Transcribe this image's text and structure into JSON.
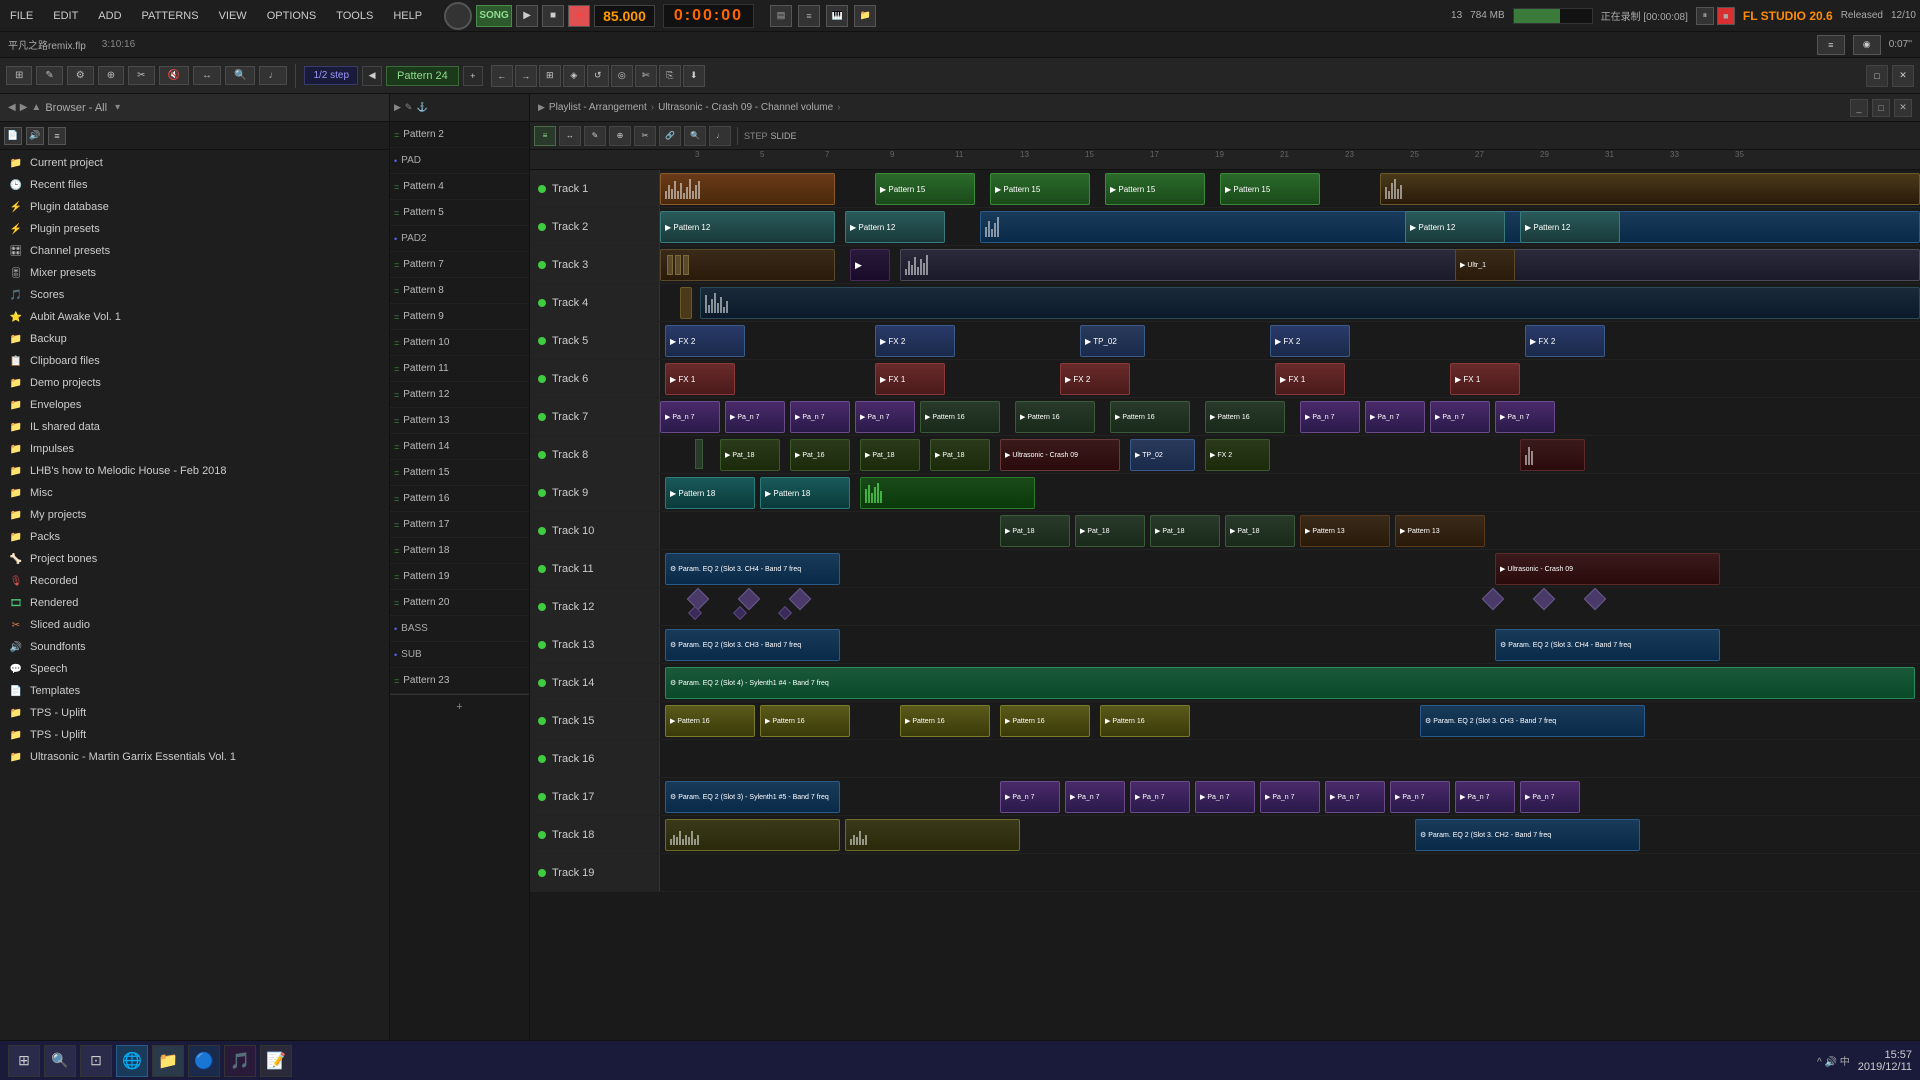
{
  "window": {
    "title": "平凡之路remix.flp",
    "time_code": "3:10:16",
    "record_time": "0:07''",
    "fl_version": "FL STUDIO 20.6",
    "release": "Released",
    "date_time": "12/10",
    "recording_time": "[00:00:08]"
  },
  "menu": {
    "items": [
      "FILE",
      "EDIT",
      "ADD",
      "PATTERNS",
      "VIEW",
      "OPTIONS",
      "TOOLS",
      "HELP"
    ]
  },
  "transport": {
    "song_label": "SONG",
    "bpm": "85.000",
    "time": "0:00:00",
    "step_label": "1/2 step",
    "pattern_label": "Pattern 24",
    "cpu_label": "13",
    "ram_label": "784 MB"
  },
  "browser": {
    "title": "Browser - All",
    "items": [
      {
        "icon": "folder",
        "label": "Current project"
      },
      {
        "icon": "recent",
        "label": "Recent files"
      },
      {
        "icon": "plug",
        "label": "Plugin database"
      },
      {
        "icon": "plug",
        "label": "Plugin presets"
      },
      {
        "icon": "channel",
        "label": "Channel presets"
      },
      {
        "icon": "mixer",
        "label": "Mixer presets"
      },
      {
        "icon": "score",
        "label": "Scores"
      },
      {
        "icon": "star",
        "label": "Aubit Awake Vol. 1"
      },
      {
        "icon": "folder",
        "label": "Backup"
      },
      {
        "icon": "folder",
        "label": "Clipboard files"
      },
      {
        "icon": "folder",
        "label": "Demo projects"
      },
      {
        "icon": "folder",
        "label": "Envelopes"
      },
      {
        "icon": "folder",
        "label": "IL shared data"
      },
      {
        "icon": "folder",
        "label": "Impulses"
      },
      {
        "icon": "folder",
        "label": "LHB's how to Melodic House - Feb 2018"
      },
      {
        "icon": "folder",
        "label": "Misc"
      },
      {
        "icon": "folder",
        "label": "My projects"
      },
      {
        "icon": "folder",
        "label": "Packs"
      },
      {
        "icon": "bones",
        "label": "Project bones"
      },
      {
        "icon": "mic",
        "label": "Recorded"
      },
      {
        "icon": "render",
        "label": "Rendered"
      },
      {
        "icon": "slice",
        "label": "Sliced audio"
      },
      {
        "icon": "sound",
        "label": "Soundfonts"
      },
      {
        "icon": "speech",
        "label": "Speech"
      },
      {
        "icon": "template",
        "label": "Templates"
      },
      {
        "icon": "tps",
        "label": "TPS - Uplift"
      },
      {
        "icon": "tps",
        "label": "TPS - Uplift"
      },
      {
        "icon": "ultra",
        "label": "Ultrasonic - Martin Garrix Essentials Vol. 1"
      }
    ]
  },
  "patterns": {
    "items": [
      "Pattern 2",
      "PAD",
      "Pattern 4",
      "Pattern 5",
      "PAD2",
      "Pattern 7",
      "Pattern 8",
      "Pattern 9",
      "Pattern 10",
      "Pattern 11",
      "Pattern 12",
      "Pattern 13",
      "Pattern 14",
      "Pattern 15",
      "Pattern 16",
      "Pattern 17",
      "Pattern 18",
      "Pattern 19",
      "Pattern 20",
      "BASS",
      "SUB",
      "Pattern 23"
    ]
  },
  "arrangement": {
    "header": "Playlist - Arrangement › Ultrasonic - Crash 09 - Channel volume ›",
    "tracks": [
      {
        "label": "Track 1",
        "led": true
      },
      {
        "label": "Track 2",
        "led": true
      },
      {
        "label": "Track 3",
        "led": true
      },
      {
        "label": "Track 4",
        "led": true
      },
      {
        "label": "Track 5",
        "led": true
      },
      {
        "label": "Track 6",
        "led": true
      },
      {
        "label": "Track 7",
        "led": true
      },
      {
        "label": "Track 8",
        "led": true
      },
      {
        "label": "Track 9",
        "led": true
      },
      {
        "label": "Track 10",
        "led": true
      },
      {
        "label": "Track 11",
        "led": true
      },
      {
        "label": "Track 12",
        "led": true
      },
      {
        "label": "Track 13",
        "led": true
      },
      {
        "label": "Track 14",
        "led": true
      },
      {
        "label": "Track 15",
        "led": true
      },
      {
        "label": "Track 16",
        "led": true
      },
      {
        "label": "Track 17",
        "led": true
      },
      {
        "label": "Track 18",
        "led": true
      },
      {
        "label": "Track 19",
        "led": true
      }
    ]
  },
  "statusbar": {
    "items": [
      "FL STUDIO 20.6",
      "Released",
      "12/10"
    ]
  },
  "taskbar": {
    "time": "15:57",
    "date": "2019/12/11"
  }
}
